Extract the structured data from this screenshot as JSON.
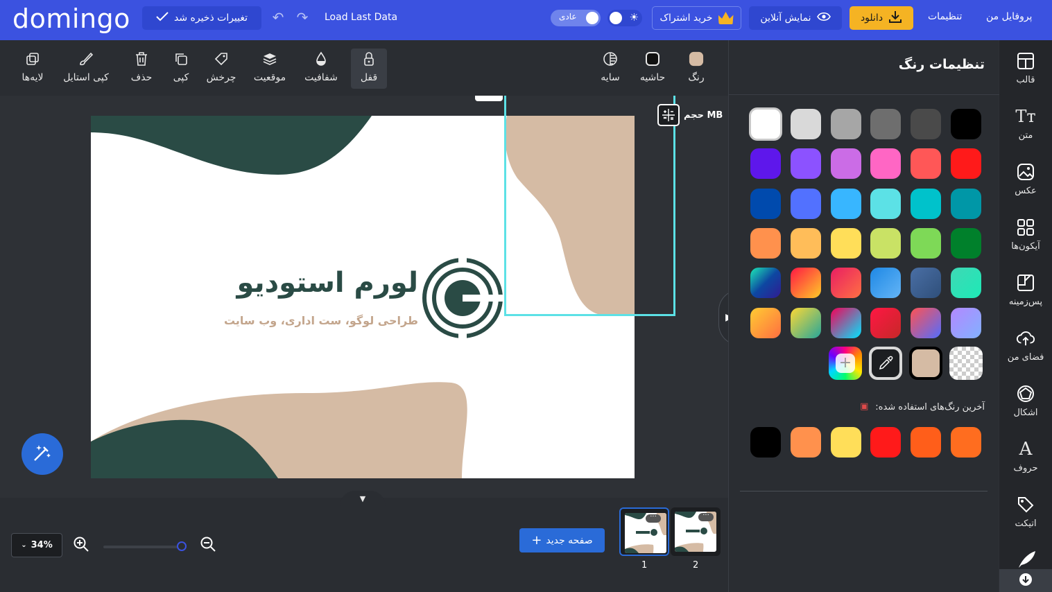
{
  "header": {
    "logo": "domingo",
    "save_status": "تغییرات ذخیره شد",
    "load_last": "Load Last Data",
    "mode_label": "عادی",
    "subscribe": "خرید اشتراک",
    "preview": "نمایش آنلاین",
    "download": "دانلود",
    "settings": "تنظیمات",
    "profile": "پروفایل من"
  },
  "toolbar": {
    "layers": "لایه‌ها",
    "copy_style": "کپی استایل",
    "delete": "حذف",
    "copy": "کپی",
    "rotate": "چرخش",
    "position": "موقعیت",
    "opacity": "شفافیت",
    "lock": "قفل",
    "shadow": "سایه",
    "border": "حاشیه",
    "color": "رنگ"
  },
  "canvas": {
    "size_label": "حجم MB",
    "logo_title": "لورم استودیو",
    "logo_subtitle": "طراحی لوگو، ست اداری، وب سایت"
  },
  "bottom": {
    "zoom": "34%",
    "new_page": "صفحه جدید",
    "pages": [
      "1",
      "2"
    ]
  },
  "panel": {
    "title": "تنظیمات رنگ",
    "recent_title": "آخرین رنگ‌های استفاده شده:",
    "palette": [
      [
        "#000000",
        "#4a4a4a",
        "#6e6e6e",
        "#a6a6a6",
        "#d9d9d9",
        "#ffffff"
      ],
      [
        "#ff1a1a",
        "#ff5757",
        "#ff66c4",
        "#cb6ce6",
        "#8c52ff",
        "#5e17eb"
      ],
      [
        "#0097a7",
        "#00c2cb",
        "#5ce1e6",
        "#38b6ff",
        "#5271ff",
        "#004aad"
      ],
      [
        "#00802b",
        "#7ed957",
        "#c9e265",
        "#ffde59",
        "#ffbd59",
        "#ff914d"
      ]
    ],
    "gradients": [
      [
        "#3fd8b5,#1de9b6",
        "#4a6fa5,#2f4f7a",
        "#1e88e5,#64b5f6",
        "#e91e63,#ff7043",
        "#ff1744,#ffca28",
        "#1de9b6,#0d47a1,#311b92"
      ],
      [
        "#b388ff,#82b1ff",
        "#ff5252,#536dfe",
        "#ff1744,#c62828",
        "#f50057,#00e5ff",
        "#fdd835,#26a69a",
        "#ffcc33,#ff6e40"
      ]
    ],
    "special_swatch": "#d5bba4",
    "recent": [
      "#ff6d1f",
      "#ff5e1a",
      "#ff1a1a",
      "#ffde59",
      "#ff914d",
      "#000000"
    ]
  },
  "nav": {
    "template": "قالب",
    "text": "متن",
    "photo": "عکس",
    "icons": "آیکون‌ها",
    "background": "پس‌زمینه",
    "my_space": "فضای من",
    "shapes": "اشکال",
    "fonts": "حروف",
    "sticker": "اتیکت"
  }
}
